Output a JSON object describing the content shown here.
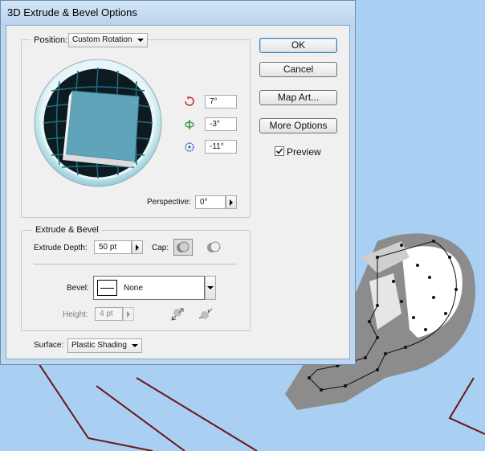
{
  "dialog": {
    "title": "3D Extrude & Bevel Options",
    "position": {
      "label": "Position:",
      "value": "Custom Rotation"
    },
    "rotation": {
      "x_value": "7°",
      "y_value": "-3°",
      "z_value": "-11°"
    },
    "perspective": {
      "label": "Perspective:",
      "value": "0°"
    },
    "extrude_bevel": {
      "group_label": "Extrude & Bevel",
      "depth_label": "Extrude Depth:",
      "depth_value": "50 pt",
      "cap_label": "Cap:",
      "bevel_label": "Bevel:",
      "bevel_value": "None",
      "height_label": "Height:",
      "height_value": "4 pt"
    },
    "surface": {
      "label": "Surface:",
      "value": "Plastic Shading"
    },
    "buttons": {
      "ok": "OK",
      "cancel": "Cancel",
      "map_art": "Map Art...",
      "more_options": "More Options"
    },
    "preview": {
      "label": "Preview",
      "checked": true
    }
  },
  "icons": {
    "rotate_x": "rotate-x-axis-icon",
    "rotate_y": "rotate-y-axis-icon",
    "rotate_z": "rotate-z-axis-icon",
    "cap_on": "cap-on-icon",
    "cap_off": "cap-off-icon",
    "bevel_out": "bevel-extent-out-icon",
    "bevel_in": "bevel-extent-in-icon"
  },
  "colors": {
    "cube_face": "#5fa4b8",
    "track_ring": "#9fd3de",
    "grid_lines": "#1b6f84",
    "artwork_shadow": "#8c8c8c"
  }
}
